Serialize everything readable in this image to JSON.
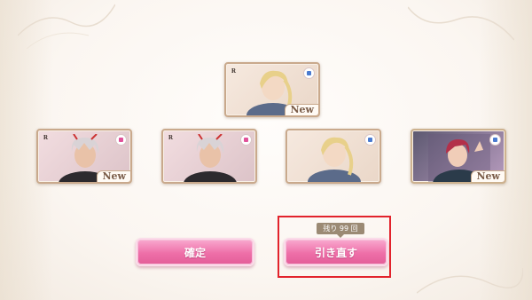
{
  "cards": [
    {
      "rarity": "R",
      "attribute_icon": "blue-attribute-icon",
      "attribute_color": "#4a7bd0",
      "is_new": true,
      "new_label": "New"
    },
    {
      "rarity": "R",
      "attribute_icon": "pink-attribute-icon",
      "attribute_color": "#e0529a",
      "is_new": true,
      "new_label": "New"
    },
    {
      "rarity": "R",
      "attribute_icon": "pink-attribute-icon",
      "attribute_color": "#e0529a",
      "is_new": false,
      "new_label": ""
    },
    {
      "rarity": "",
      "attribute_icon": "blue-attribute-icon",
      "attribute_color": "#4a7bd0",
      "is_new": false,
      "new_label": ""
    },
    {
      "rarity": "",
      "attribute_icon": "blue-attribute-icon",
      "attribute_color": "#4a7bd0",
      "is_new": true,
      "new_label": "New"
    }
  ],
  "buttons": {
    "confirm_label": "確定",
    "redraw_label": "引き直す"
  },
  "remaining_badge": "残り 99 回",
  "colors": {
    "button_pink": "#ee6fa8",
    "highlight_red": "#e2232c",
    "badge_brown": "#9b8a74",
    "card_border": "#c9a98c"
  }
}
